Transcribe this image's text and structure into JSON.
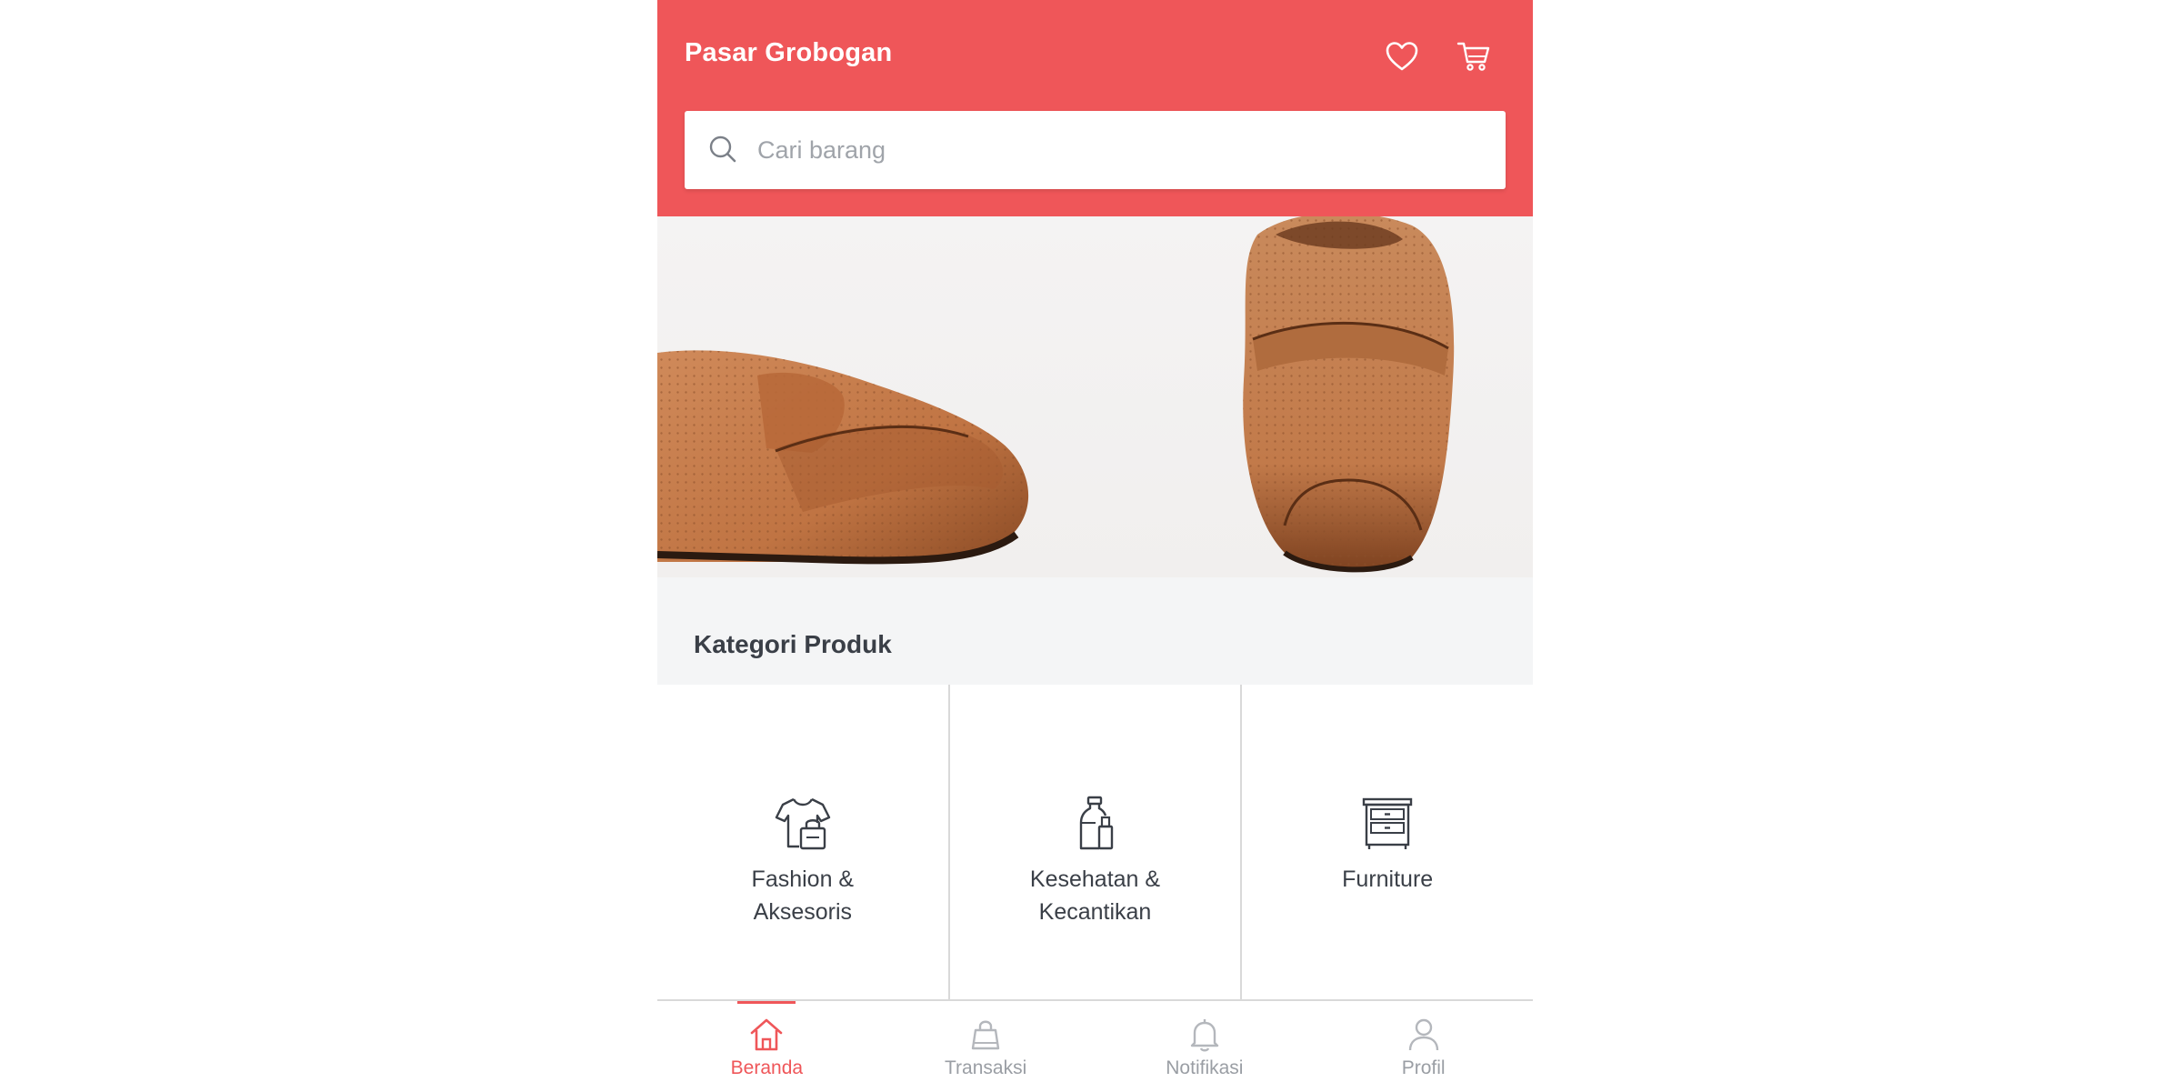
{
  "header": {
    "brand": "Pasar Grobogan",
    "wishlist_icon": "heart-icon",
    "cart_icon": "cart-icon"
  },
  "search": {
    "placeholder": "Cari barang",
    "value": "",
    "icon": "search-icon"
  },
  "banner": {
    "image": "brown leather loafers photo"
  },
  "categories": {
    "title": "Kategori Produk",
    "items": [
      {
        "label": "Fashion & Aksesoris",
        "icon": "shirt-bag-icon"
      },
      {
        "label": "Kesehatan & Kecantikan",
        "icon": "bottle-icon"
      },
      {
        "label": "Furniture",
        "icon": "drawer-cabinet-icon"
      }
    ]
  },
  "bottom_nav": {
    "items": [
      {
        "label": "Beranda",
        "icon": "home-icon",
        "active": true
      },
      {
        "label": "Transaksi",
        "icon": "shopping-bag-icon",
        "active": false
      },
      {
        "label": "Notifikasi",
        "icon": "bell-icon",
        "active": false
      },
      {
        "label": "Profil",
        "icon": "user-icon",
        "active": false
      }
    ]
  },
  "colors": {
    "primary": "#ef5659",
    "text_dark": "#3a3f47",
    "text_muted": "#9a9ea4"
  }
}
